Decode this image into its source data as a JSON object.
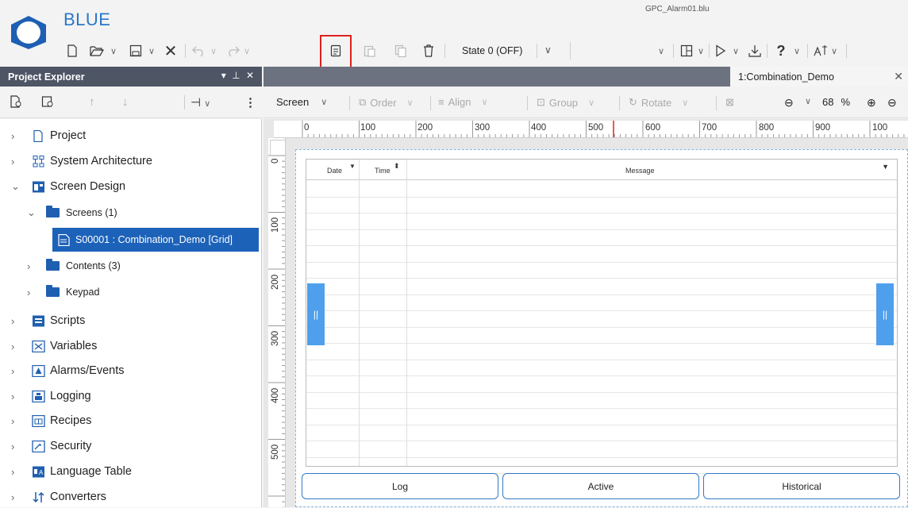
{
  "app": {
    "name": "BLUE",
    "file_name": "GPC_Alarm01.blu"
  },
  "toolbar": {
    "state_value": "State 0 (OFF)",
    "help_glyph": "?",
    "items": [
      "new-file-icon",
      "open-icon",
      "save-icon",
      "close-icon",
      "undo-icon",
      "redo-icon",
      "copy-icon",
      "paste-icon",
      "duplicate-icon",
      "delete-icon",
      "layout-icon",
      "run-icon",
      "download-icon",
      "help-icon",
      "text-style-icon"
    ]
  },
  "explorer": {
    "title": "Project Explorer",
    "tree": [
      {
        "label": "Project"
      },
      {
        "label": "System Architecture"
      },
      {
        "label": "Screen Design"
      },
      {
        "label": "Screens (1)"
      },
      {
        "label": "S00001 : Combination_Demo [Grid]"
      },
      {
        "label": "Contents (3)"
      },
      {
        "label": "Keypad"
      },
      {
        "label": "Scripts"
      },
      {
        "label": "Variables"
      },
      {
        "label": "Alarms/Events"
      },
      {
        "label": "Logging"
      },
      {
        "label": "Recipes"
      },
      {
        "label": "Security"
      },
      {
        "label": "Language Table"
      },
      {
        "label": "Converters"
      }
    ]
  },
  "document": {
    "tab_title": "1:Combination_Demo",
    "toolbar": {
      "screen": "Screen",
      "order": "Order",
      "align": "Align",
      "group": "Group",
      "rotate": "Rotate",
      "zoom_value": "68",
      "zoom_unit": "%"
    }
  },
  "ruler": {
    "h_labels": [
      "0",
      "100",
      "200",
      "300",
      "400",
      "500",
      "600",
      "700",
      "800",
      "900",
      "100"
    ],
    "v_labels": [
      "0",
      "100",
      "200",
      "300",
      "400",
      "500"
    ]
  },
  "alarm_table": {
    "columns": [
      "Date",
      "Time",
      "Message"
    ]
  },
  "buttons": {
    "log": "Log",
    "active": "Active",
    "historical": "Historical"
  },
  "colors": {
    "accent": "#1c62b9",
    "panel_header": "#4e5565",
    "highlight": "#e02020",
    "grip": "#4fa0ec"
  }
}
